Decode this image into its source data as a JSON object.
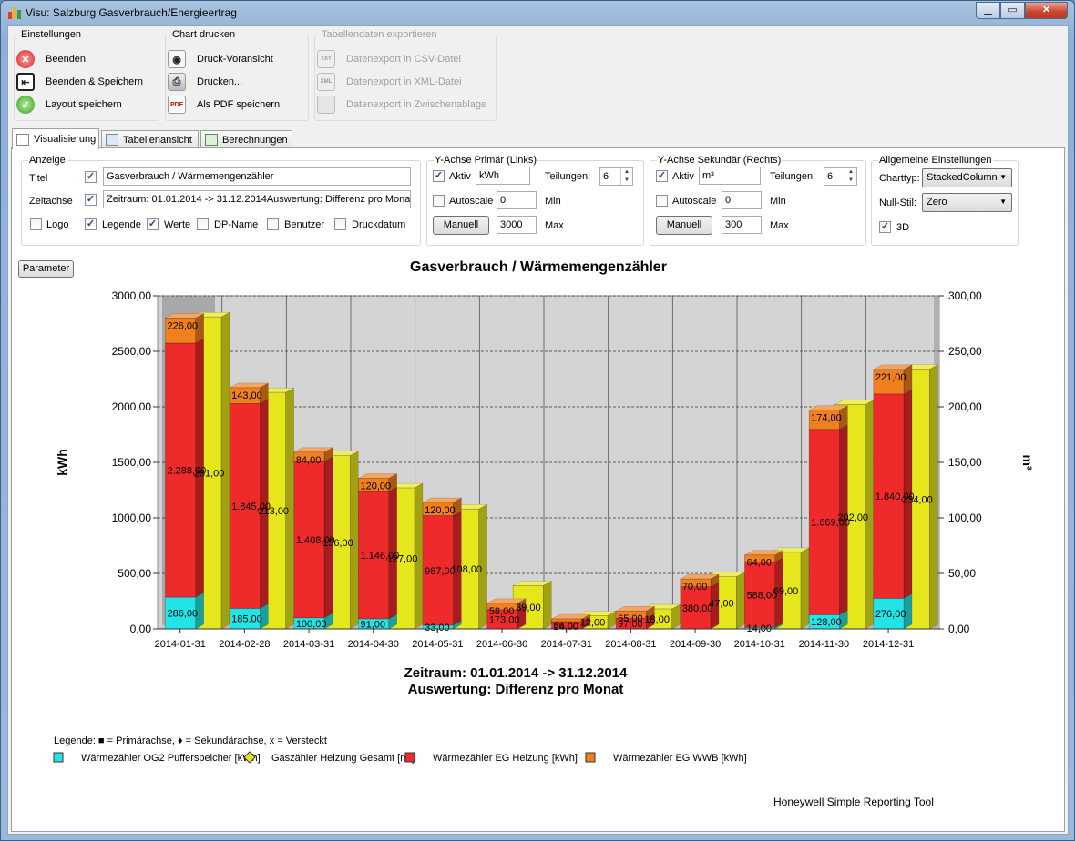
{
  "window": {
    "title": "Visu: Salzburg Gasverbrauch/Energieertrag",
    "min": "▁",
    "max": "▭",
    "close": "✕"
  },
  "toolbar": {
    "einstellungen": {
      "title": "Einstellungen",
      "items": [
        {
          "label": "Beenden",
          "icon": "close-red-icon"
        },
        {
          "label": "Beenden & Speichern",
          "icon": "exit-save-icon"
        },
        {
          "label": "Layout speichern",
          "icon": "checkmark-green-icon"
        }
      ]
    },
    "chart_drucken": {
      "title": "Chart drucken",
      "items": [
        {
          "label": "Druck-Voransicht",
          "icon": "eye-icon"
        },
        {
          "label": "Drucken...",
          "icon": "printer-icon"
        },
        {
          "label": "Als PDF speichern",
          "icon": "pdf-icon"
        }
      ]
    },
    "export": {
      "title": "Tabellendaten exportieren",
      "items": [
        {
          "label": "Datenexport in CSV-Datei",
          "icon": "csv-icon",
          "icon_text": "TXT"
        },
        {
          "label": "Datenexport in XML-Datei",
          "icon": "xml-icon",
          "icon_text": "XML"
        },
        {
          "label": "Datenexport in Zwischenablage",
          "icon": "clipboard-icon",
          "icon_text": ""
        }
      ]
    }
  },
  "tabs": [
    {
      "label": "Visualisierung",
      "active": true
    },
    {
      "label": "Tabellenansicht",
      "active": false
    },
    {
      "label": "Berechnungen",
      "active": false
    }
  ],
  "anzeige": {
    "title": "Anzeige",
    "titel_label": "Titel",
    "titel_value": "Gasverbrauch / Wärmemengenzähler",
    "zeitachse_label": "Zeitachse",
    "zeitachse_value": "Zeitraum: 01.01.2014 -> 31.12.2014Auswertung: Differenz pro Monat",
    "logo": "Logo",
    "legende": "Legende",
    "werte": "Werte",
    "dpname": "DP-Name",
    "benutzer": "Benutzer",
    "druckdatum": "Druckdatum"
  },
  "y_primary": {
    "title": "Y-Achse Primär (Links)",
    "aktiv": "Aktiv",
    "unit": "kWh",
    "teilungen_label": "Teilungen:",
    "teilungen": "6",
    "autoscale": "Autoscale",
    "min": "0",
    "min_label": "Min",
    "manuell": "Manuell",
    "max": "3000",
    "max_label": "Max"
  },
  "y_secondary": {
    "title": "Y-Achse Sekundär (Rechts)",
    "aktiv": "Aktiv",
    "unit": "m³",
    "teilungen_label": "Teilungen:",
    "teilungen": "6",
    "autoscale": "Autoscale",
    "min": "0",
    "min_label": "Min",
    "manuell": "Manuell",
    "max": "300",
    "max_label": "Max"
  },
  "allgemein": {
    "title": "Allgemeine Einstellungen",
    "charttyp_label": "Charttyp:",
    "charttyp": "StackedColumn",
    "nullstil_label": "Null-Stil:",
    "nullstil": "Zero",
    "3d": "3D"
  },
  "parameter_button": "Parameter",
  "colors": {
    "cyan": "#22e4e6",
    "yellow": "#e6e61c",
    "red": "#ef2a2a",
    "orange": "#f07f1e",
    "plot_bg": "#d4d4d4"
  },
  "chart_data": {
    "type": "bar",
    "title": "Gasverbrauch / Wärmemengenzähler",
    "subtitle_line1": "Zeitraum: 01.01.2014 -> 31.12.2014",
    "subtitle_line2": "Auswertung: Differenz pro Monat",
    "ylabel": "kWh",
    "y2label": "m³",
    "ylim": [
      0,
      3000
    ],
    "y2lim": [
      0,
      300
    ],
    "yticks": [
      "0,00",
      "500,00",
      "1000,00",
      "1500,00",
      "2000,00",
      "2500,00",
      "3000,00"
    ],
    "y2ticks": [
      "0,00",
      "50,00",
      "100,00",
      "150,00",
      "200,00",
      "250,00",
      "300,00"
    ],
    "grid": true,
    "3d": true,
    "categories": [
      "2014-01-31",
      "2014-02-28",
      "2014-03-31",
      "2014-04-30",
      "2014-05-31",
      "2014-06-30",
      "2014-07-31",
      "2014-08-31",
      "2014-09-30",
      "2014-10-31",
      "2014-11-30",
      "2014-12-31"
    ],
    "stack_primary": [
      {
        "name": "Wärmezähler OG2 Pufferspeicher [kWh]",
        "color": "#22e4e6",
        "values": [
          286,
          185,
          100,
          91,
          33,
          0,
          0,
          0,
          0,
          14,
          128,
          276
        ],
        "labels": [
          "286,00",
          "185,00",
          "100,00",
          "91,00",
          "33,00",
          "",
          "",
          "",
          "",
          "14,00",
          "128,00",
          "276,00"
        ]
      },
      {
        "name": "Wärmezähler EG Heizung [kWh]",
        "color": "#ef2a2a",
        "values": [
          2288,
          1845,
          1408,
          1146,
          987,
          173,
          66,
          97,
          380,
          588,
          1669,
          1840
        ],
        "labels": [
          "2.288,00",
          "1.845,00",
          "1.408,00",
          "1.146,00",
          "987,00",
          "173,00",
          "66,00",
          "97,00",
          "380,00",
          "588,00",
          "1.669,00",
          "1.840,00"
        ]
      },
      {
        "name": "Wärmezähler EG WWB [kWh]",
        "color": "#f07f1e",
        "values": [
          226,
          143,
          84,
          120,
          120,
          58,
          24,
          65,
          70,
          64,
          174,
          221
        ],
        "labels": [
          "226,00",
          "143,00",
          "84,00",
          "120,00",
          "120,00",
          "58,00",
          "24,00",
          "65,00",
          "70,00",
          "64,00",
          "174,00",
          "221,00"
        ]
      }
    ],
    "secondary": {
      "name": "Gaszähler Heizung Gesamt [m³]",
      "color": "#e6e61c",
      "values": [
        281,
        213,
        156,
        127,
        108,
        39,
        12,
        18,
        47,
        69,
        202,
        234
      ],
      "labels": [
        "281,00",
        "213,00",
        "156,00",
        "127,00",
        "108,00",
        "39,00",
        "12,00",
        "18,00",
        "47,00",
        "69,00",
        "202,00",
        "234,00"
      ]
    },
    "legend_header": "Legende: ■ = Primärachse, ♦ = Sekundärachse, x = Versteckt",
    "legend": [
      {
        "name": "Wärmezähler OG2 Pufferspeicher [kWh]",
        "color": "#22e4e6"
      },
      {
        "name": "Gaszähler Heizung Gesamt [m³]",
        "color": "#e6e61c"
      },
      {
        "name": "Wärmezähler EG Heizung [kWh]",
        "color": "#ef2a2a"
      },
      {
        "name": "Wärmezähler EG WWB [kWh]",
        "color": "#f07f1e"
      }
    ],
    "footer": "Honeywell Simple Reporting Tool"
  }
}
